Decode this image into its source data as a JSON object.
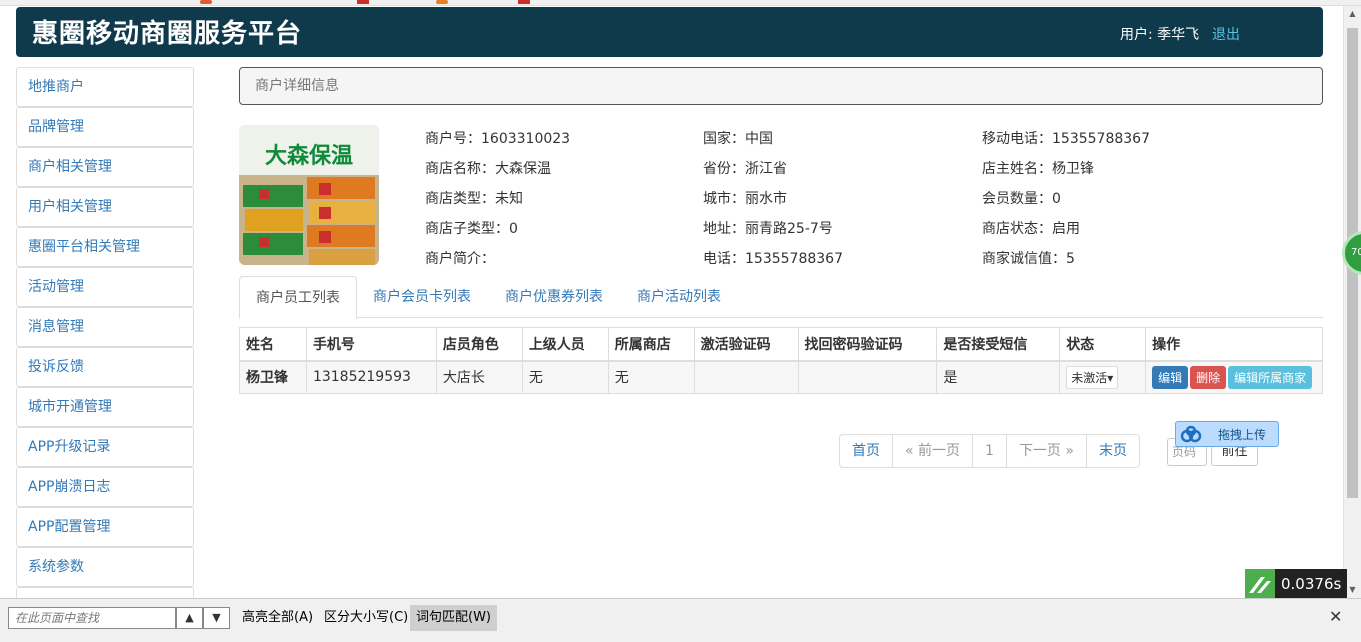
{
  "header": {
    "brand": "惠圈移动商圈服务平台",
    "user_label": "用户: 季华飞",
    "logout": "退出"
  },
  "sidebar": {
    "items": [
      {
        "label": "地推商户"
      },
      {
        "label": "品牌管理"
      },
      {
        "label": "商户相关管理"
      },
      {
        "label": "用户相关管理"
      },
      {
        "label": "惠圈平台相关管理"
      },
      {
        "label": "活动管理"
      },
      {
        "label": "消息管理"
      },
      {
        "label": "投诉反馈"
      },
      {
        "label": "城市开通管理"
      },
      {
        "label": "APP升级记录"
      },
      {
        "label": "APP崩溃日志"
      },
      {
        "label": "APP配置管理"
      },
      {
        "label": "系统参数"
      }
    ]
  },
  "panel": {
    "title": "商户详细信息"
  },
  "shop": {
    "sign_text": "大森保温"
  },
  "details": {
    "col1": [
      "商户号：1603310023",
      "商店名称：大森保温",
      "商店类型：未知",
      "商店子类型：0",
      "商户简介："
    ],
    "col2": [
      "国家：中国",
      "省份：浙江省",
      "城市：丽水市",
      "地址：丽青路25-7号",
      "电话：15355788367"
    ],
    "col3": [
      "移动电话：15355788367",
      "店主姓名：杨卫锋",
      "会员数量：0",
      "商店状态：启用",
      "商家诚信值：5"
    ]
  },
  "tabs": [
    "商户员工列表",
    "商户会员卡列表",
    "商户优惠券列表",
    "商户活动列表"
  ],
  "table": {
    "headers": [
      "姓名",
      "手机号",
      "店员角色",
      "上级人员",
      "所属商店",
      "激活验证码",
      "找回密码验证码",
      "是否接受短信",
      "状态",
      "操作"
    ],
    "rows": [
      {
        "name": "杨卫锋",
        "phone": "13185219593",
        "role": "大店长",
        "superior": "无",
        "shop": "无",
        "activate_code": "",
        "reset_code": "",
        "sms": "是",
        "status": "未激活"
      }
    ],
    "actions": {
      "edit": "编辑",
      "delete": "删除",
      "edit_shop": "编辑所属商家"
    }
  },
  "pager": {
    "first": "首页",
    "prev": "« 前一页",
    "current": "1",
    "next": "下一页 »",
    "last": "末页",
    "page_placeholder": "页码",
    "goto": "前往"
  },
  "upload": {
    "label": "拖拽上传"
  },
  "side_badge": {
    "text": "70"
  },
  "timing": {
    "value": "0.0376s"
  },
  "findbar": {
    "placeholder": "在此页面中查找",
    "highlight_all": "高亮全部(A)",
    "match_case": "区分大小写(C)",
    "whole_word": "词句匹配(W)"
  }
}
